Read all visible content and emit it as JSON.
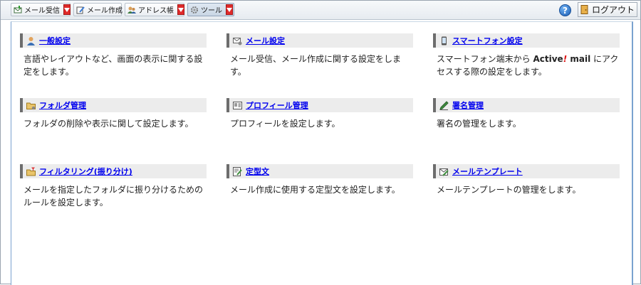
{
  "toolbar": {
    "buttons": [
      {
        "label": "メール受信",
        "icon": "mail-receive-icon",
        "has_dropdown": true
      },
      {
        "label": "メール作成",
        "icon": "mail-compose-icon",
        "has_dropdown": false
      },
      {
        "label": "アドレス帳",
        "icon": "address-book-icon",
        "has_dropdown": true
      },
      {
        "label": "ツール",
        "icon": "gear-icon",
        "has_dropdown": true,
        "active": true
      }
    ],
    "help_label": "?",
    "logout_label": "ログアウト"
  },
  "settings": [
    {
      "title": "一般設定",
      "icon": "user-settings-icon",
      "desc": "言語やレイアウトなど、画面の表示に関する設定をします。"
    },
    {
      "title": "メール設定",
      "icon": "mail-settings-icon",
      "desc": "メール受信、メール作成に関する設定をします。"
    },
    {
      "title": "スマートフォン設定",
      "icon": "smartphone-icon",
      "desc_parts": {
        "before": "スマートフォン端末から ",
        "brand_active": "Active",
        "brand_bang": "!",
        "brand_mail": " mail",
        "after": " にアクセスする際の設定をします。"
      }
    },
    {
      "title": "フォルダ管理",
      "icon": "folder-icon",
      "desc": "フォルダの削除や表示に関して設定します。"
    },
    {
      "title": "プロフィール管理",
      "icon": "profile-card-icon",
      "desc": "プロフィールを設定します。"
    },
    {
      "title": "署名管理",
      "icon": "pen-icon",
      "desc": "署名の管理をします。"
    },
    {
      "title": "フィルタリング(振り分け)",
      "icon": "filter-icon",
      "desc": "メールを指定したフォルダに振り分けるためのルールを設定します。"
    },
    {
      "title": "定型文",
      "icon": "template-text-icon",
      "desc": "メール作成に使用する定型文を設定します。"
    },
    {
      "title": "メールテンプレート",
      "icon": "mail-template-icon",
      "desc": "メールテンプレートの管理をします。"
    }
  ],
  "colors": {
    "link": "#0000ee",
    "header_bar": "#ececec",
    "header_accent": "#6d6d6d",
    "dropdown_red": "#e02a2a",
    "content_border": "#7aa2cf"
  }
}
